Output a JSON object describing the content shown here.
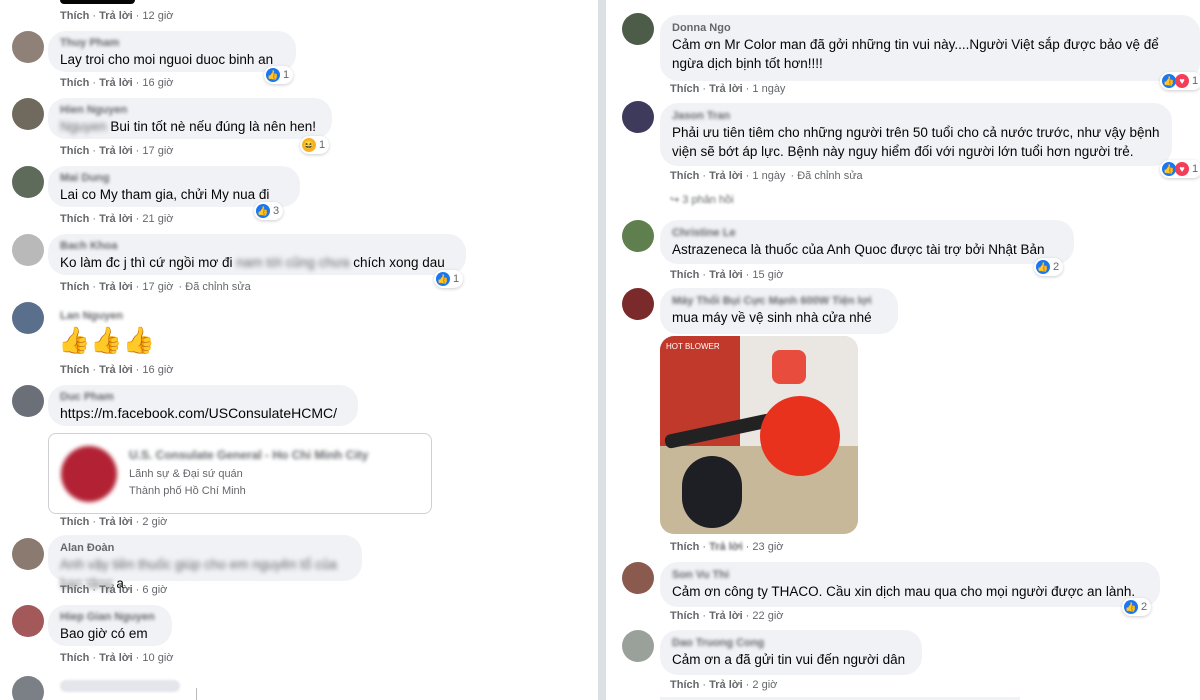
{
  "actions": {
    "like": "Thích",
    "reply": "Trả lời",
    "edited": "Đã chỉnh sửa"
  },
  "left": {
    "top_action_time": "12 giờ",
    "comments": [
      {
        "name": "Thuy Pham",
        "text": "Lay troi cho moi nguoi duoc binh an",
        "time": "16 giờ",
        "reactions": "1"
      },
      {
        "name": "Hien Nguyen",
        "blurred_prefix": "Nguyen",
        "text": "Bui tin tốt nè nếu đúng là nên hen!",
        "time": "17 giờ",
        "reactions": "1"
      },
      {
        "name": "Mai Dung",
        "text": "Lai co My tham gia, chửi My nua đi",
        "time": "21 giờ",
        "reactions": "3"
      },
      {
        "name": "Bach Khoa",
        "text_a": "Ko làm đc j thì cứ ngồi mơ đi",
        "text_blur": "nam tới cũng chưa",
        "text_b": "chích xong dau",
        "time": "17 giờ",
        "reactions": "1"
      },
      {
        "name": "Lan Nguyen",
        "thumbs": "👍👍👍",
        "time": "16 giờ"
      },
      {
        "name": "Duc Pham",
        "text": "https://m.facebook.com/USConsulateHCMC/",
        "card": {
          "title": "U.S. Consulate General - Ho Chi Minh City",
          "subtitle": "Lãnh sự & Đại sứ quán",
          "location": "Thành phố Hồ Chí Minh"
        },
        "time": "2 giờ"
      },
      {
        "name": "Alan Đoàn",
        "text_blur": "Anh vậy tiền thuốc giúp cho em nguyên tổ của bạn tặng",
        "text_b": "a",
        "time": "6 giờ"
      },
      {
        "name": "Hiep Gian Nguyen",
        "text": "Bao giờ có em",
        "time": "10 giờ"
      }
    ]
  },
  "right": {
    "comments": [
      {
        "name": "Donna Ngo",
        "text": "Cảm ơn Mr Color man đã gởi những tin vui này....Người Việt sắp được bảo vệ để\nngừa dịch bịnh tốt hơn!!!!",
        "time": "1 ngày",
        "reactions": "1"
      },
      {
        "name": "Jason Tran",
        "text": "Phải ưu tiên tiêm cho những người trên 50 tuổi cho cả nước trước, như vậy bệnh\nviện sẽ bớt áp lực. Bệnh này nguy hiểm đối với người lớn tuổi hơn người trẻ.",
        "time": "1 ngày",
        "reactions": "1",
        "more_replies": "3 phản hồi"
      },
      {
        "name": "Christine Le",
        "text": "Astrazeneca là thuốc của Anh Quoc được tài trợ bởi Nhật Bản",
        "time": "15 giờ",
        "reactions": "2"
      },
      {
        "name": "Máy Thổi Bụi Cực Mạnh 600W Tiện lợi",
        "text": "mua máy về vệ sinh nhà cửa nhé",
        "time": "23 giờ",
        "photo_label": "HOT BLOWER"
      },
      {
        "name": "Son Vu Thi",
        "text": "Cảm ơn công ty THACO. Cầu xin dịch mau qua cho mọi người được an lành.",
        "time": "22 giờ",
        "reactions": "2"
      },
      {
        "name": "Dao Truong Cong",
        "text": "Cảm ơn a đã gửi tin vui đến người dân",
        "time": "2 giờ"
      }
    ]
  },
  "colors": {
    "like": "#1877f2",
    "heart": "#f33e58",
    "haha": "#f7b125",
    "bubble": "#f0f2f5",
    "meta": "#65676b"
  }
}
